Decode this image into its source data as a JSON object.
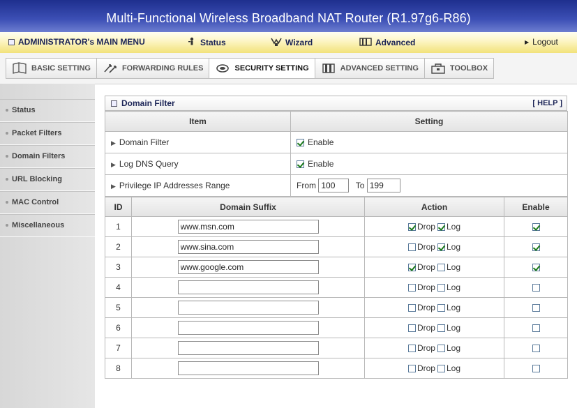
{
  "title": "Multi-Functional Wireless Broadband NAT Router (R1.97g6-R86)",
  "menu": {
    "admin_label": "ADMINISTRATOR's MAIN MENU",
    "status_label": "Status",
    "wizard_label": "Wizard",
    "advanced_label": "Advanced",
    "logout_label": "Logout"
  },
  "tabs": [
    {
      "label": "BASIC SETTING",
      "icon": "book-icon"
    },
    {
      "label": "FORWARDING RULES",
      "icon": "arrows-icon"
    },
    {
      "label": "SECURITY SETTING",
      "icon": "lock-icon"
    },
    {
      "label": "ADVANCED SETTING",
      "icon": "gear-icon"
    },
    {
      "label": "TOOLBOX",
      "icon": "toolbox-icon"
    }
  ],
  "sidebar": {
    "items": [
      "Status",
      "Packet Filters",
      "Domain Filters",
      "URL Blocking",
      "MAC Control",
      "Miscellaneous"
    ]
  },
  "panel": {
    "title": "Domain Filter",
    "help": "[ HELP ]",
    "col_item": "Item",
    "col_setting": "Setting",
    "domain_filter_label": "Domain Filter",
    "domain_filter_enable": "Enable",
    "domain_filter_checked": true,
    "log_dns_label": "Log DNS Query",
    "log_dns_enable": "Enable",
    "log_dns_checked": true,
    "privilege_label": "Privilege IP Addresses Range",
    "from_label": "From",
    "from_value": "100",
    "to_label": "To",
    "to_value": "199"
  },
  "rules": {
    "headers": {
      "id": "ID",
      "suffix": "Domain Suffix",
      "action": "Action",
      "enable": "Enable"
    },
    "drop_label": "Drop",
    "log_label": "Log",
    "rows": [
      {
        "id": "1",
        "suffix": "www.msn.com",
        "drop": true,
        "log": true,
        "enable": true
      },
      {
        "id": "2",
        "suffix": "www.sina.com",
        "drop": false,
        "log": true,
        "enable": true
      },
      {
        "id": "3",
        "suffix": "www.google.com",
        "drop": true,
        "log": false,
        "enable": true
      },
      {
        "id": "4",
        "suffix": "",
        "drop": false,
        "log": false,
        "enable": false
      },
      {
        "id": "5",
        "suffix": "",
        "drop": false,
        "log": false,
        "enable": false
      },
      {
        "id": "6",
        "suffix": "",
        "drop": false,
        "log": false,
        "enable": false
      },
      {
        "id": "7",
        "suffix": "",
        "drop": false,
        "log": false,
        "enable": false
      },
      {
        "id": "8",
        "suffix": "",
        "drop": false,
        "log": false,
        "enable": false
      }
    ]
  }
}
